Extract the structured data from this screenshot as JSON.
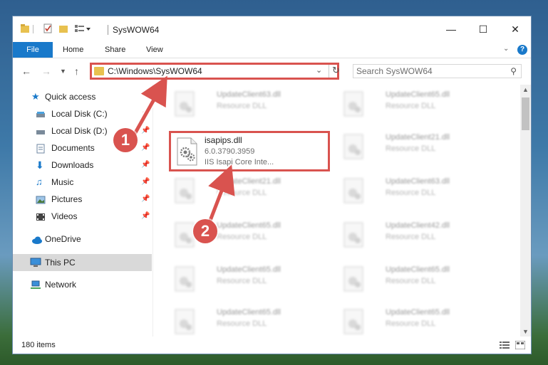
{
  "window": {
    "title": "SysWOW64"
  },
  "ribbon": {
    "tabs": [
      "File",
      "Home",
      "Share",
      "View"
    ]
  },
  "address": {
    "path": "C:\\Windows\\SysWOW64"
  },
  "search": {
    "placeholder": "Search SysWOW64"
  },
  "sidebar": {
    "items": [
      {
        "label": "Quick access",
        "icon": "star-icon"
      },
      {
        "label": "Local Disk (C:)",
        "icon": "drive-icon",
        "pinned": true
      },
      {
        "label": "Local Disk (D:)",
        "icon": "drive-icon",
        "pinned": true
      },
      {
        "label": "Documents",
        "icon": "documents-icon",
        "pinned": true
      },
      {
        "label": "Downloads",
        "icon": "download-icon",
        "pinned": true
      },
      {
        "label": "Music",
        "icon": "music-icon",
        "pinned": true
      },
      {
        "label": "Pictures",
        "icon": "pictures-icon",
        "pinned": true
      },
      {
        "label": "Videos",
        "icon": "videos-icon",
        "pinned": true
      },
      {
        "label": "OneDrive",
        "icon": "cloud-icon"
      },
      {
        "label": "This PC",
        "icon": "computer-icon",
        "selected": true
      },
      {
        "label": "Network",
        "icon": "network-icon"
      }
    ]
  },
  "files": [
    {
      "name": "UpdateClient63.dll",
      "desc": "Resource DLL"
    },
    {
      "name": "UpdateClient65.dll",
      "desc": "Resource DLL"
    },
    {
      "name": "UpdateClient21.dll",
      "desc": "Resource DLL"
    },
    {
      "name": "UpdateClient21.dll",
      "desc": "Resource DLL"
    },
    {
      "name": "UpdateClient63.dll",
      "desc": "Resource DLL"
    },
    {
      "name": "UpdateClient65.dll",
      "desc": "Resource DLL"
    },
    {
      "name": "UpdateClient42.dll",
      "desc": "Resource DLL"
    },
    {
      "name": "UpdateClient65.dll",
      "desc": "Resource DLL"
    },
    {
      "name": "UpdateClient65.dll",
      "desc": "Resource DLL"
    },
    {
      "name": "UpdateClient65.dll",
      "desc": "Resource DLL"
    }
  ],
  "highlighted_file": {
    "name": "isapips.dll",
    "version": "6.0.3790.3959",
    "desc": "IIS Isapi Core Inte..."
  },
  "status": {
    "count": "180 items"
  },
  "callouts": [
    "1",
    "2"
  ],
  "colors": {
    "accent": "#1979ca",
    "highlight": "#d9534f"
  }
}
